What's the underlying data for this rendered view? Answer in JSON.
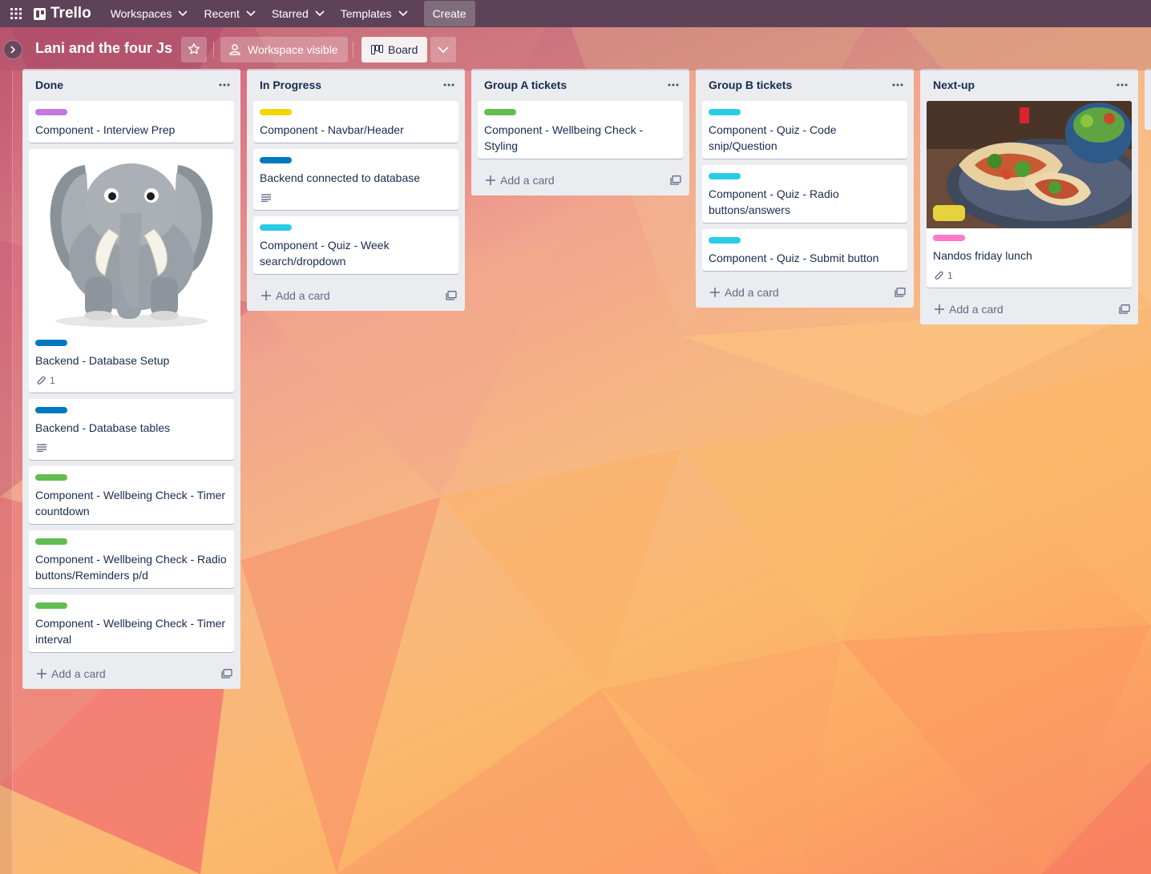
{
  "topbar": {
    "logo_text": "Trello",
    "menus": [
      {
        "label": "Workspaces"
      },
      {
        "label": "Recent"
      },
      {
        "label": "Starred"
      },
      {
        "label": "Templates"
      }
    ],
    "create_label": "Create"
  },
  "board": {
    "title": "Lani and the four Js",
    "visibility_label": "Workspace visible",
    "view_label": "Board"
  },
  "lists": [
    {
      "title": "Done",
      "add_card_label": "Add a card",
      "cards": [
        {
          "label_color": "#c377e0",
          "title": "Component - Interview Prep"
        },
        {
          "cover": "elephant",
          "label_color": "#0079bf",
          "title": "Backend - Database Setup",
          "attachments": "1"
        },
        {
          "label_color": "#0079bf",
          "title": "Backend - Database tables",
          "description_icon": "description-icon"
        },
        {
          "label_color": "#61bd4f",
          "title": "Component - Wellbeing Check - Timer countdown"
        },
        {
          "label_color": "#61bd4f",
          "title": "Component - Wellbeing Check - Radio buttons/Reminders p/d"
        },
        {
          "label_color": "#61bd4f",
          "title": "Component - Wellbeing Check - Timer interval"
        }
      ]
    },
    {
      "title": "In Progress",
      "add_card_label": "Add a card",
      "cards": [
        {
          "label_color": "#f2d600",
          "title": "Component - Navbar/Header"
        },
        {
          "label_color": "#0079bf",
          "title": "Backend connected to database",
          "description_icon": "description-icon"
        },
        {
          "label_color": "#29cce5",
          "title": "Component - Quiz - Week search/dropdown"
        }
      ]
    },
    {
      "title": "Group A tickets",
      "add_card_label": "Add a card",
      "cards": [
        {
          "label_color": "#61bd4f",
          "title": "Component - Wellbeing Check - Styling"
        }
      ]
    },
    {
      "title": "Group B tickets",
      "add_card_label": "Add a card",
      "cards": [
        {
          "label_color": "#29cce5",
          "title": "Component - Quiz - Code snip/Question"
        },
        {
          "label_color": "#29cce5",
          "title": "Component - Quiz - Radio buttons/answers"
        },
        {
          "label_color": "#29cce5",
          "title": "Component - Quiz - Submit button"
        }
      ]
    },
    {
      "title": "Next-up",
      "add_card_label": "Add a card",
      "cards": [
        {
          "cover": "food",
          "label_color": "#ff78cb",
          "title": "Nandos friday lunch",
          "attachments": "1"
        }
      ]
    }
  ]
}
